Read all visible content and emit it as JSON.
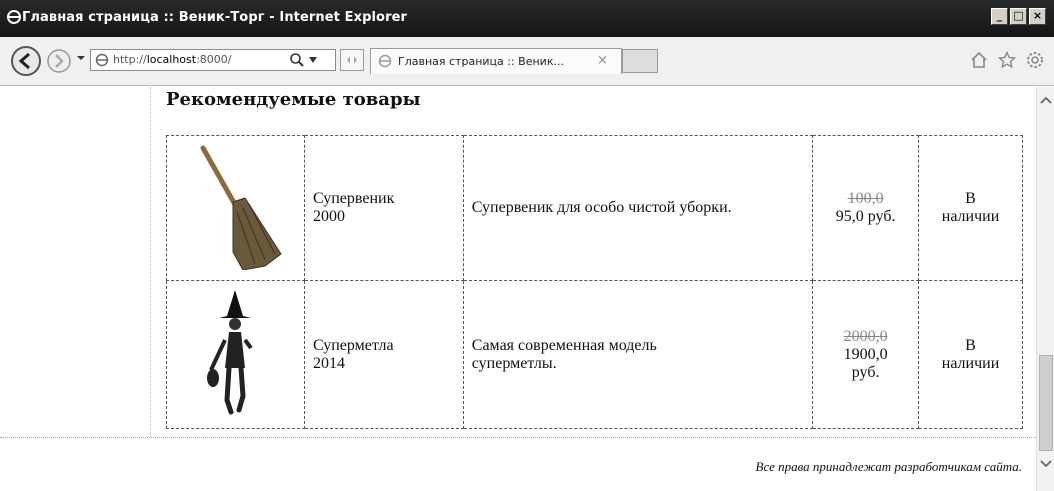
{
  "window": {
    "title": "Главная страница :: Веник-Торг - Internet Explorer"
  },
  "nav": {
    "url_prefix": "http://",
    "url_host": "localhost",
    "url_port": ":8000/",
    "tab_label": "Главная страница :: Веник...",
    "tab_close": "×"
  },
  "page": {
    "heading": "Рекомендуемые товары",
    "products": [
      {
        "image_icon": "broom-icon",
        "name_line1": "Супервеник",
        "name_line2": "2000",
        "description": "Супервеник для особо чистой уборки.",
        "old_price": "100,0",
        "price": "95,0 руб.",
        "stock_line1": "В",
        "stock_line2": "наличии"
      },
      {
        "image_icon": "witch-icon",
        "name_line1": "Суперметла",
        "name_line2": "2014",
        "description_line1": "Самая современная модель",
        "description_line2": "суперметлы.",
        "old_price": "2000,0",
        "price_line1": "1900,0",
        "price_line2": "руб.",
        "stock_line1": "В",
        "stock_line2": "наличии"
      }
    ],
    "footer": "Все права принадлежат разработчикам сайта."
  },
  "colors": {
    "titlebar": "#1e1e1e",
    "navbar": "#f0f0f0",
    "text": "#111111"
  }
}
